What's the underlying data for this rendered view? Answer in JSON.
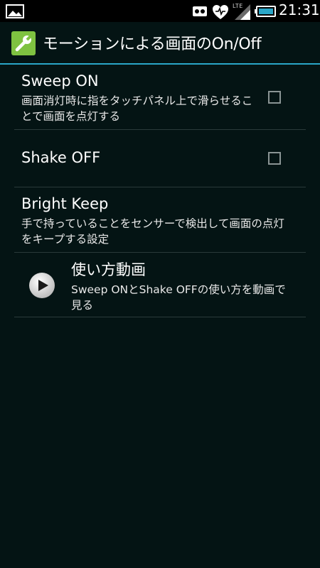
{
  "status_bar": {
    "time": "21:31",
    "network_type": "LTE",
    "icons": [
      "gallery-icon",
      "mail-icon",
      "health-icon",
      "signal-icon",
      "battery-icon"
    ]
  },
  "action_bar": {
    "title": "モーションによる画面のOn/Off",
    "icon": "wrench-icon",
    "accent_color": "#2aa6c8",
    "icon_color": "#7fc241"
  },
  "settings": [
    {
      "title": "Sweep ON",
      "summary": "画面消灯時に指をタッチパネル上で滑らせることで画面を点灯する",
      "checked": false
    },
    {
      "title": "Shake OFF",
      "summary": "",
      "checked": false
    },
    {
      "title": "Bright Keep",
      "summary": "手で持っていることをセンサーで検出して画面の点灯をキープする設定"
    }
  ],
  "video": {
    "title": "使い方動画",
    "summary": "Sweep ONとShake OFFの使い方を動画で見る",
    "icon": "play-icon"
  }
}
